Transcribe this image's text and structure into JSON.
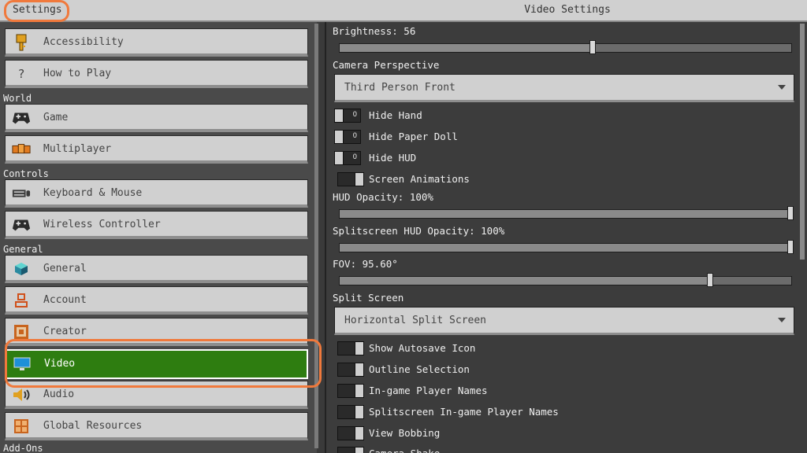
{
  "header": {
    "back_label": "Settings",
    "title": "Video Settings"
  },
  "sidebar": {
    "items": [
      {
        "label": "Accessibility",
        "icon": "key-icon"
      },
      {
        "label": "How to Play",
        "icon": "question-icon",
        "glyph": "?"
      },
      {
        "label": "Game",
        "icon": "controller-icon"
      },
      {
        "label": "Multiplayer",
        "icon": "multiplayer-icon"
      },
      {
        "label": "Keyboard & Mouse",
        "icon": "keyboard-icon"
      },
      {
        "label": "Wireless Controller",
        "icon": "controller-icon"
      },
      {
        "label": "General",
        "icon": "cube-icon"
      },
      {
        "label": "Account",
        "icon": "account-icon"
      },
      {
        "label": "Creator",
        "icon": "creator-icon"
      },
      {
        "label": "Video",
        "icon": "monitor-icon",
        "selected": true
      },
      {
        "label": "Audio",
        "icon": "speaker-icon"
      },
      {
        "label": "Global Resources",
        "icon": "resources-icon"
      }
    ],
    "sections": {
      "world": "World",
      "controls": "Controls",
      "general": "General",
      "addons": "Add-Ons"
    }
  },
  "settings": {
    "brightness": {
      "label": "Brightness: 56",
      "value": 56
    },
    "camera": {
      "label": "Camera Perspective",
      "value": "Third Person Front"
    },
    "hide_hand": {
      "label": "Hide Hand",
      "on": false
    },
    "hide_paper_doll": {
      "label": "Hide Paper Doll",
      "on": false
    },
    "hide_hud": {
      "label": "Hide HUD",
      "on": false
    },
    "screen_animations": {
      "label": "Screen Animations",
      "on": true
    },
    "hud_opacity": {
      "label": "HUD Opacity: 100%",
      "value": 100
    },
    "split_hud_opacity": {
      "label": "Splitscreen HUD Opacity: 100%",
      "value": 100
    },
    "fov": {
      "label": "FOV: 95.60°",
      "value": 95.6
    },
    "split_screen": {
      "label": "Split Screen",
      "value": "Horizontal Split Screen"
    },
    "show_autosave": {
      "label": "Show Autosave Icon",
      "on": true
    },
    "outline_selection": {
      "label": "Outline Selection",
      "on": true
    },
    "player_names": {
      "label": "In-game Player Names",
      "on": true
    },
    "split_player_names": {
      "label": "Splitscreen In-game Player Names",
      "on": true
    },
    "view_bobbing": {
      "label": "View Bobbing",
      "on": true
    },
    "camera_shake": {
      "label": "Camera Shake",
      "on": true
    }
  },
  "colors": {
    "highlight": "#f0793c",
    "selected": "#2e7d10"
  }
}
